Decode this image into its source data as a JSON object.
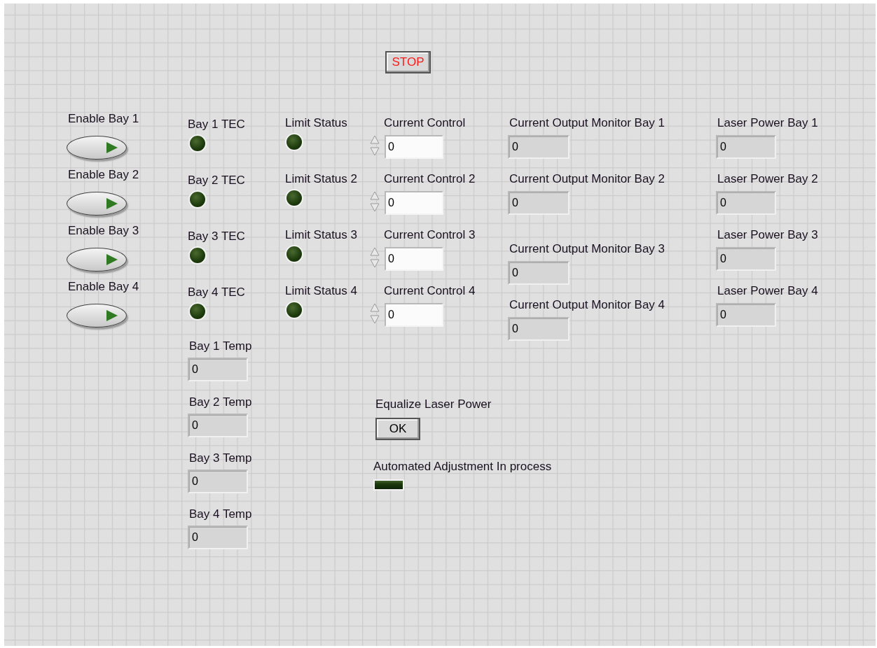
{
  "stop_button": {
    "label": "STOP"
  },
  "enable_switches": [
    {
      "label": "Enable Bay 1",
      "on": false
    },
    {
      "label": "Enable Bay 2",
      "on": false
    },
    {
      "label": "Enable Bay 3",
      "on": false
    },
    {
      "label": "Enable Bay 4",
      "on": false
    }
  ],
  "tec_leds": [
    {
      "label": "Bay 1 TEC",
      "on": false
    },
    {
      "label": "Bay 2 TEC",
      "on": false
    },
    {
      "label": "Bay 3 TEC",
      "on": false
    },
    {
      "label": "Bay 4 TEC",
      "on": false
    }
  ],
  "limit_leds": [
    {
      "label": "Limit Status",
      "on": false
    },
    {
      "label": "Limit Status 2",
      "on": false
    },
    {
      "label": "Limit Status 3",
      "on": false
    },
    {
      "label": "Limit Status 4",
      "on": false
    }
  ],
  "current_controls": [
    {
      "label": "Current Control",
      "value": "0"
    },
    {
      "label": "Current Control 2",
      "value": "0"
    },
    {
      "label": "Current Control 3",
      "value": "0"
    },
    {
      "label": "Current Control 4",
      "value": "0"
    }
  ],
  "output_monitors": [
    {
      "label": "Current Output Monitor Bay 1",
      "value": "0"
    },
    {
      "label": "Current Output Monitor Bay 2",
      "value": "0"
    },
    {
      "label": "Current Output Monitor Bay 3",
      "value": "0"
    },
    {
      "label": "Current Output Monitor Bay 4",
      "value": "0"
    }
  ],
  "laser_power": [
    {
      "label": "Laser Power Bay 1",
      "value": "0"
    },
    {
      "label": "Laser Power Bay 2",
      "value": "0"
    },
    {
      "label": "Laser Power Bay 3",
      "value": "0"
    },
    {
      "label": "Laser Power Bay 4",
      "value": "0"
    }
  ],
  "temperatures": [
    {
      "label": "Bay 1 Temp",
      "value": "0"
    },
    {
      "label": "Bay 2 Temp",
      "value": "0"
    },
    {
      "label": "Bay 3 Temp",
      "value": "0"
    },
    {
      "label": "Bay 4 Temp",
      "value": "0"
    }
  ],
  "equalize": {
    "label": "Equalize Laser Power",
    "button": "OK"
  },
  "automated_adjustment": {
    "label": "Automated Adjustment In process",
    "on": false
  }
}
